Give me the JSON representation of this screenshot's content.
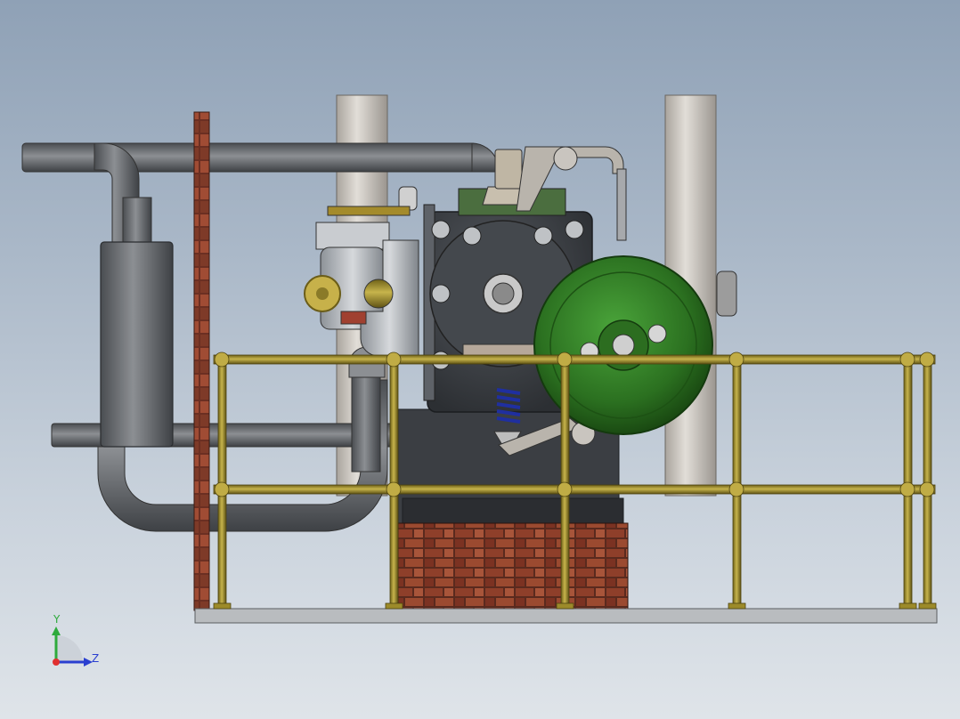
{
  "viewport": {
    "background_top": "#8fa1b6",
    "background_bottom": "#dfe4e9"
  },
  "colors": {
    "brass": "#9c8a2a",
    "brass_light": "#c9b650",
    "pipe_gray": "#6f7276",
    "flywheel": "#c8c4be",
    "engine_body": "#3a3d42",
    "green_wheel": "#2f7a23",
    "brick": "#8a3d2a",
    "base_plate": "#b9bcbf",
    "axis_x": "#e03030",
    "axis_y": "#2eaa3c",
    "axis_z": "#2a3fd0"
  },
  "model": {
    "parts": [
      "exhaust-pipe",
      "muffler",
      "brick-wall-post",
      "flywheel-left",
      "flywheel-right",
      "engine-block",
      "carburetor",
      "magneto-wheel",
      "brick-foundation",
      "safety-railing",
      "base-plate",
      "governor-arm"
    ]
  },
  "triad": {
    "y_label": "Y",
    "z_label": "Z",
    "icon": "axis-triad-icon"
  }
}
